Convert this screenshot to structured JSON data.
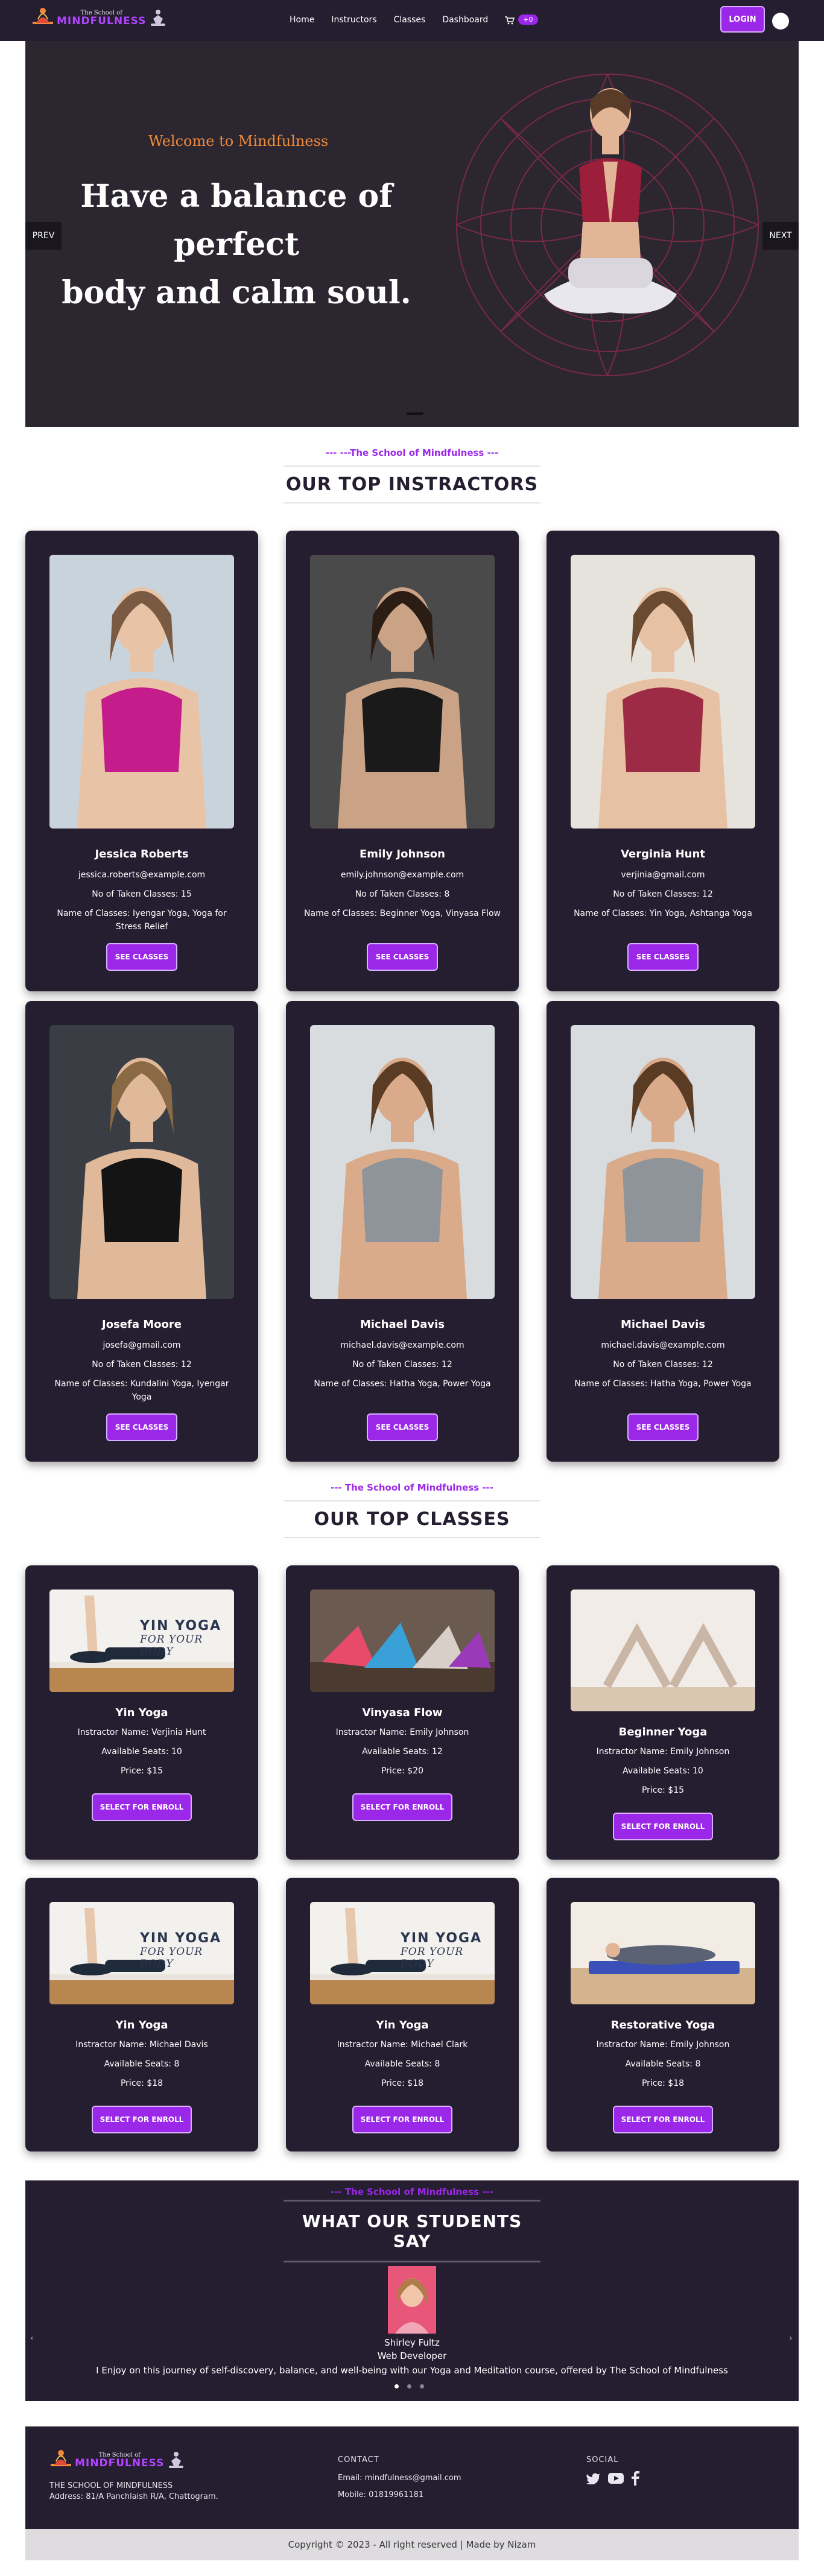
{
  "brand": {
    "small": "The School of",
    "big": "MINDFULNESS"
  },
  "nav": {
    "items": [
      "Home",
      "Instructors",
      "Classes",
      "Dashboard"
    ],
    "cart_count": "+0",
    "login": "LOGIN"
  },
  "hero": {
    "welcome": "Welcome to Mindfulness",
    "title_line1": "Have a balance of perfect",
    "title_line2": "body and calm soul.",
    "prev": "PREV",
    "next": "NEXT"
  },
  "instructors_section": {
    "subtitle": "--- ---The School of Mindfulness ---",
    "title": "OUR TOP INSTRACTORS",
    "items": [
      {
        "name": "Jessica Roberts",
        "email": "jessica.roberts@example.com",
        "taken": "No of Taken Classes: 15",
        "classes": "Name of Classes: Iyengar Yoga, Yoga for Stress Relief",
        "button": "SEE CLASSES"
      },
      {
        "name": "Emily Johnson",
        "email": "emily.johnson@example.com",
        "taken": "No of Taken Classes: 8",
        "classes": "Name of Classes: Beginner Yoga, Vinyasa Flow",
        "button": "SEE CLASSES"
      },
      {
        "name": "Verginia Hunt",
        "email": "verjinia@gmail.com",
        "taken": "No of Taken Classes: 12",
        "classes": "Name of Classes: Yin Yoga, Ashtanga Yoga",
        "button": "SEE CLASSES"
      },
      {
        "name": "Josefa Moore",
        "email": "josefa@gmail.com",
        "taken": "No of Taken Classes: 12",
        "classes": "Name of Classes: Kundalini Yoga, Iyengar Yoga",
        "button": "SEE CLASSES"
      },
      {
        "name": "Michael Davis",
        "email": "michael.davis@example.com",
        "taken": "No of Taken Classes: 12",
        "classes": "Name of Classes: Hatha Yoga, Power Yoga",
        "button": "SEE CLASSES"
      },
      {
        "name": "Michael Davis",
        "email": "michael.davis@example.com",
        "taken": "No of Taken Classes: 12",
        "classes": "Name of Classes: Hatha Yoga, Power Yoga",
        "button": "SEE CLASSES"
      }
    ]
  },
  "classes_section": {
    "subtitle": "--- The School of Mindfulness ---",
    "title": "OUR TOP CLASSES",
    "items": [
      {
        "name": "Yin Yoga",
        "instructor": "Instractor Name: Verjinia Hunt",
        "seats": "Available Seats: 10",
        "price": "Price: $15",
        "button": "SELECT FOR ENROLL",
        "banner_l1": "YIN YOGA",
        "banner_l2": "FOR YOUR BODY"
      },
      {
        "name": "Vinyasa Flow",
        "instructor": "Instractor Name: Emily Johnson",
        "seats": "Available Seats: 12",
        "price": "Price: $20",
        "button": "SELECT FOR ENROLL"
      },
      {
        "name": "Beginner Yoga",
        "instructor": "Instractor Name: Emily Johnson",
        "seats": "Available Seats: 10",
        "price": "Price: $15",
        "button": "SELECT FOR ENROLL"
      },
      {
        "name": "Yin Yoga",
        "instructor": "Instractor Name: Michael Davis",
        "seats": "Available Seats: 8",
        "price": "Price: $18",
        "button": "SELECT FOR ENROLL",
        "banner_l1": "YIN YOGA",
        "banner_l2": "FOR YOUR BODY"
      },
      {
        "name": "Yin Yoga",
        "instructor": "Instractor Name: Michael Clark",
        "seats": "Available Seats: 8",
        "price": "Price: $18",
        "button": "SELECT FOR ENROLL",
        "banner_l1": "YIN YOGA",
        "banner_l2": "FOR YOUR BODY"
      },
      {
        "name": "Restorative Yoga",
        "instructor": "Instractor Name: Emily Johnson",
        "seats": "Available Seats: 8",
        "price": "Price: $18",
        "button": "SELECT FOR ENROLL"
      }
    ]
  },
  "testimonials": {
    "subtitle": "--- The School of Mindfulness ---",
    "title": "WHAT OUR STUDENTS SAY",
    "name": "Shirley Fultz",
    "role": "Web Developer",
    "quote": "I Enjoy on this journey of self-discovery, balance, and well-being with our Yoga and Meditation course, offered by The School of Mindfulness",
    "prev": "‹",
    "next": "›"
  },
  "footer": {
    "address_l1": "THE SCHOOL OF MINDFULNESS",
    "address_l2": "Address: 81/A Panchlaish R/A, Chattogram.",
    "contact_heading": "CONTACT",
    "email": "Email: mindfulness@gmail.com",
    "mobile": "Mobile: 01819961181",
    "social_heading": "SOCIAL",
    "social": [
      "twitter-icon",
      "youtube-icon",
      "facebook-icon"
    ]
  },
  "copyright": "Copyright © 2023 - All right reserved | Made by Nizam",
  "colors": {
    "brand_purple": "#9b27e8",
    "dark_bg": "#251d30",
    "hero_accent": "#f08a3a"
  }
}
